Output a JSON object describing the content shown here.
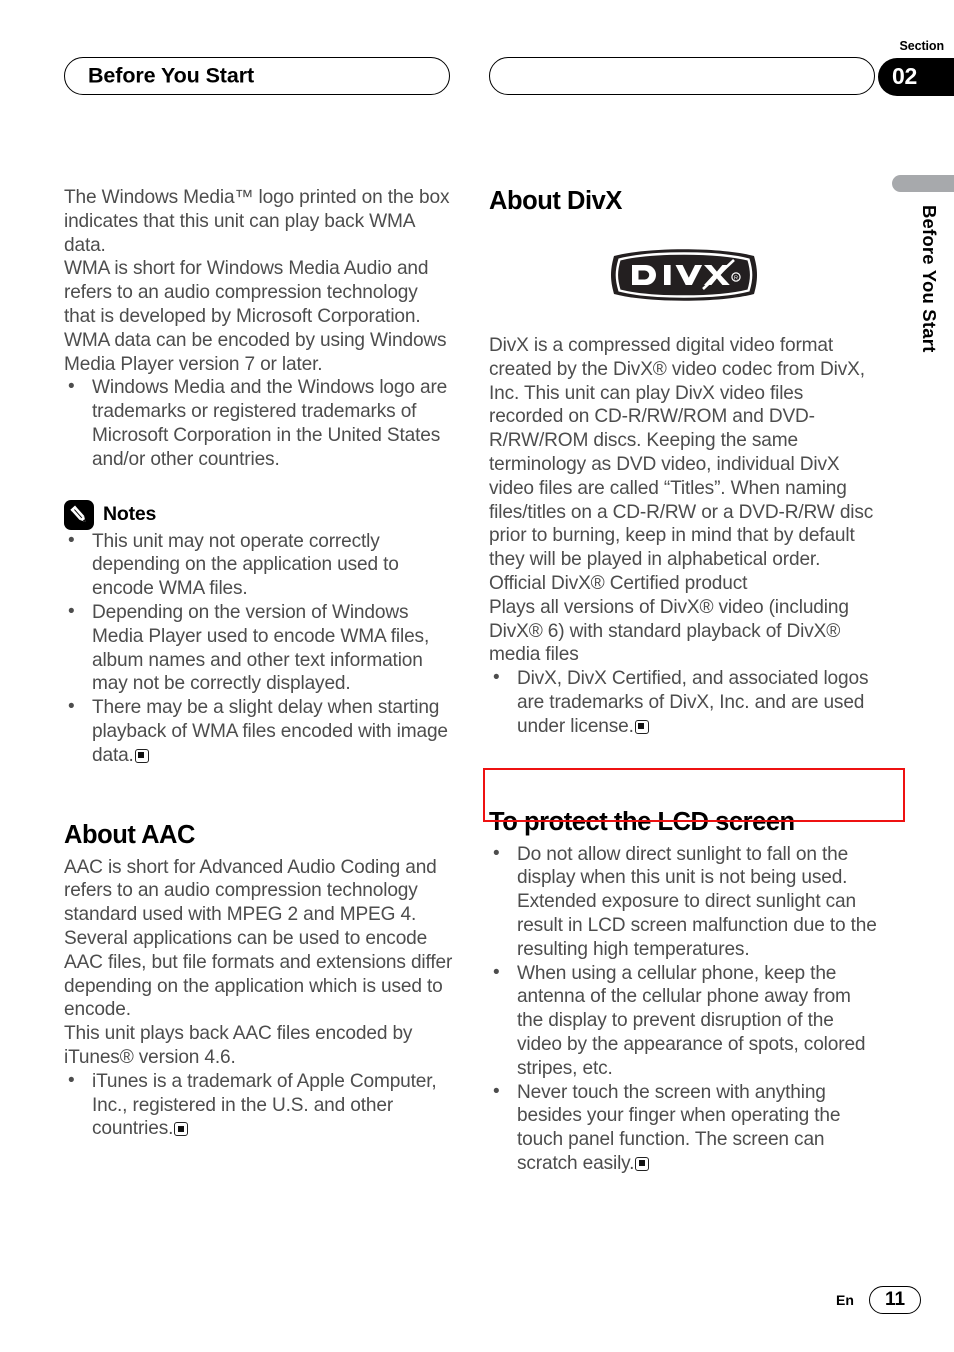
{
  "header": {
    "left_tab_label": "Before You Start",
    "right_tab_label": "",
    "section_word": "Section",
    "section_number": "02"
  },
  "side_tab": {
    "label": "Before You Start"
  },
  "left_column": {
    "intro_paragraphs": [
      "The Windows Media™ logo printed on the box indicates that this unit can play back WMA data.",
      "WMA is short for Windows Media Audio and refers to an audio compression technology that is developed by Microsoft Corporation. WMA data can be encoded by using Windows Media Player version 7 or later."
    ],
    "intro_bullets": [
      "Windows Media and the Windows logo are trademarks or registered trademarks of Microsoft Corporation in the United States and/or other countries."
    ],
    "notes": {
      "icon": "pencil-icon",
      "label": "Notes",
      "items": [
        "This unit may not operate correctly depending on the application used to encode WMA files.",
        "Depending on the version of Windows Media Player used to encode WMA files, album names and other text information may not be correctly displayed.",
        "There may be a slight delay when starting playback of WMA files encoded with image data."
      ],
      "last_item_has_endmark": true
    },
    "aac": {
      "heading": "About AAC",
      "paragraphs": [
        "AAC is short for Advanced Audio Coding and refers to an audio compression technology standard used with MPEG 2 and MPEG 4. Several applications can be used to encode AAC files, but file formats and extensions differ depending on the application which is used to encode.",
        "This unit plays back AAC files encoded by iTunes® version 4.6."
      ],
      "bullets": [
        "iTunes is a trademark of Apple Computer, Inc., registered in the U.S. and other countries."
      ],
      "last_bullet_has_endmark": true
    }
  },
  "right_column": {
    "divx": {
      "heading": "About DivX",
      "logo": {
        "name": "divx-logo",
        "wordmark": "DivX",
        "registered": "®",
        "background_color": "#231f20",
        "text_color": "#ffffff"
      },
      "paragraphs": [
        "DivX is a compressed digital video format created by the DivX® video codec from DivX, Inc. This unit can play DivX video files recorded on CD-R/RW/ROM and DVD-R/RW/ROM discs. Keeping the same terminology as DVD video, individual DivX video files are called “Titles”. When naming files/titles on a CD-R/RW or a DVD-R/RW disc prior to burning, keep in mind that by default they will be played in alphabetical order.",
        "Official DivX® Certified product",
        "Plays all versions of DivX® video (including DivX® 6) with standard playback of DivX® media files"
      ],
      "bullets": [
        "DivX, DivX Certified, and associated logos are trademarks of DivX, Inc. and are used under license."
      ],
      "last_bullet_has_endmark": true
    },
    "annotation_box": {
      "name": "red-highlight-box",
      "border_color": "#ee1111",
      "content": ""
    },
    "lcd": {
      "heading": "To protect the LCD screen",
      "bullets": [
        "Do not allow direct sunlight to fall on the display when this unit is not being used. Extended exposure to direct sunlight can result in LCD screen malfunction due to the resulting high temperatures.",
        "When using a cellular phone, keep the antenna of the cellular phone away from the display to prevent disruption of the video by the appearance of spots, colored stripes, etc.",
        "Never touch the screen with anything besides your finger when operating the touch panel function. The screen can scratch easily."
      ],
      "last_bullet_has_endmark": true
    }
  },
  "footer": {
    "language": "En",
    "page_number": "11"
  }
}
